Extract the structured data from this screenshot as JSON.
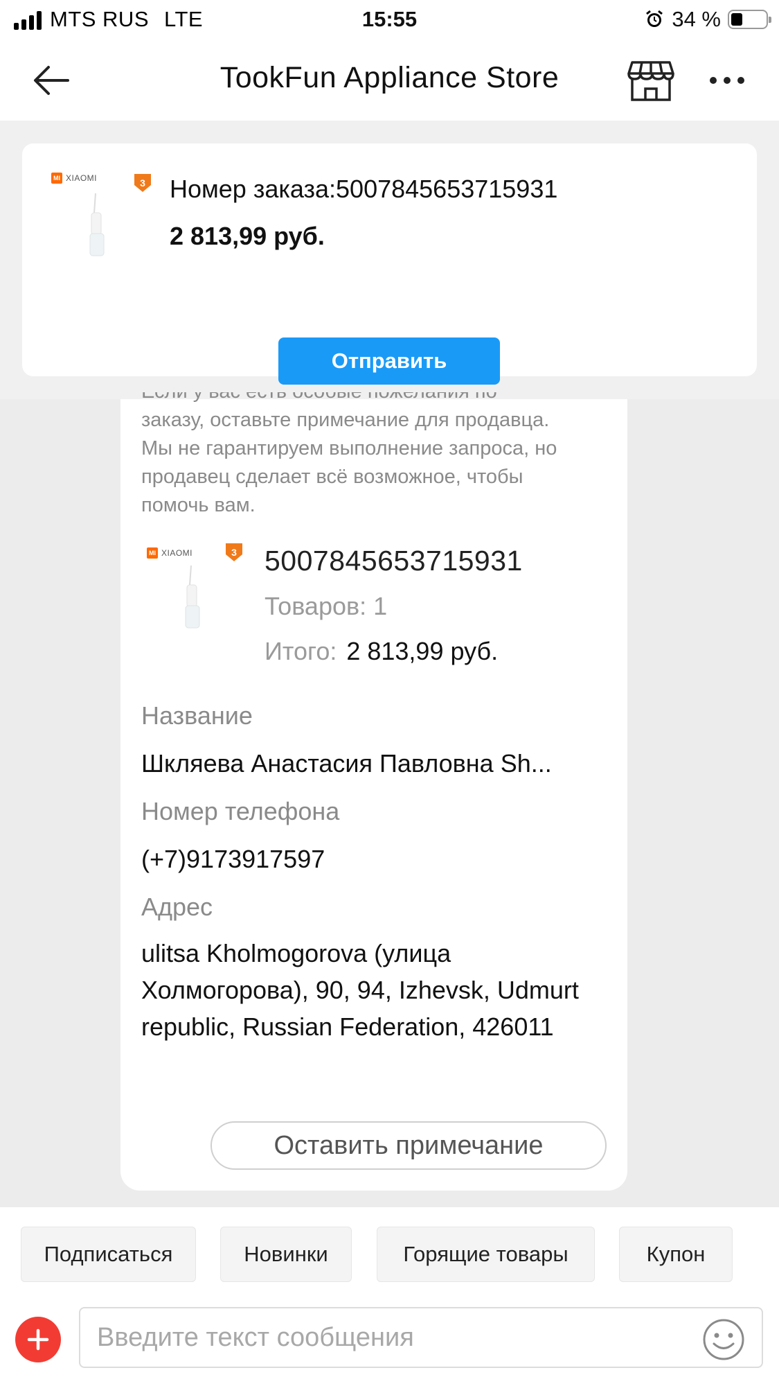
{
  "status_bar": {
    "carrier": "MTS RUS",
    "network": "LTE",
    "time": "15:55",
    "battery_text": "34 %",
    "battery_level": 0.34
  },
  "nav": {
    "title": "TookFun Appliance Store",
    "back_icon": "arrow-left-icon",
    "store_icon": "store-icon",
    "more_icon": "more-dots-icon"
  },
  "product": {
    "brand_logo": "MI",
    "brand_name": "XIAOMI",
    "badge_icon": "warranty-3-badge-icon"
  },
  "pinned_order": {
    "order_number": "Номер заказа:5007845653715931",
    "price": "2 813,99 руб.",
    "send_label": "Отправить"
  },
  "message": {
    "info_lines": [
      "Если у вас есть особые пожелания по",
      "заказу, оставьте примечание для продавца.",
      "Мы не гарантируем выполнение запроса, но",
      "продавец сделает всё возможное, чтобы",
      "помочь вам."
    ],
    "order_number": "5007845653715931",
    "items": "Товаров: 1",
    "total_label": "Итого:",
    "total_value": "2 813,99 руб.",
    "name_label": "Название",
    "name_value": "Шкляева Анастасия Павловна  Sh...",
    "phone_label": "Номер телефона",
    "phone_value": "(+7)9173917597",
    "address_label": "Адрес",
    "address_value": "ulitsa Kholmogorova (улица Холмогорова), 90, 94, Izhevsk, Udmurt republic, Russian Federation, 426011",
    "note_button": "Оставить примечание"
  },
  "quick_replies": [
    "Подписаться",
    "Новинки",
    "Горящие товары",
    "Купон"
  ],
  "input": {
    "placeholder": "Введите текст сообщения",
    "add_icon": "plus-icon",
    "emoji_icon": "smiley-icon"
  },
  "colors": {
    "accent_blue": "#1a9af7",
    "add_red": "#f23c33",
    "xiaomi_orange": "#ff6900"
  }
}
